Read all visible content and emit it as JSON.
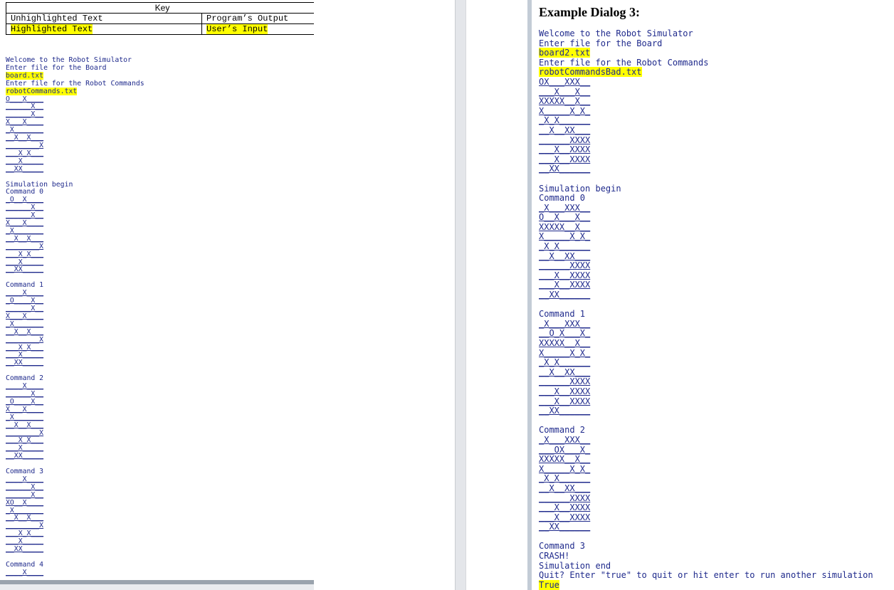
{
  "key": {
    "title": "Key",
    "rows": [
      {
        "left": "Unhighlighted Text",
        "right": "Program’s Output"
      },
      {
        "left": "Highlighted Text",
        "right": "User’s Input"
      }
    ]
  },
  "left_console": [
    {
      "t": "Welcome to the Robot Simulator",
      "k": "text"
    },
    {
      "t": "Enter file for the Board",
      "k": "text"
    },
    {
      "t": "board.txt",
      "k": "input"
    },
    {
      "t": "Enter file for the Robot Commands",
      "k": "text"
    },
    {
      "t": "robotCommands.txt",
      "k": "input"
    },
    {
      "t": "O___X____",
      "k": "grid"
    },
    {
      "t": "______X__",
      "k": "grid"
    },
    {
      "t": "______X__",
      "k": "grid"
    },
    {
      "t": "X___X____",
      "k": "grid"
    },
    {
      "t": "_X_______",
      "k": "grid"
    },
    {
      "t": "__X__X___",
      "k": "grid"
    },
    {
      "t": "________X",
      "k": "grid"
    },
    {
      "t": "___X_X___",
      "k": "grid"
    },
    {
      "t": "___X_____",
      "k": "grid"
    },
    {
      "t": "__XX_____",
      "k": "grid"
    },
    {
      "t": "",
      "k": "text"
    },
    {
      "t": "Simulation begin",
      "k": "text"
    },
    {
      "t": "Command 0",
      "k": "text"
    },
    {
      "t": "_O__X____",
      "k": "grid"
    },
    {
      "t": "______X__",
      "k": "grid"
    },
    {
      "t": "______X__",
      "k": "grid"
    },
    {
      "t": "X___X____",
      "k": "grid"
    },
    {
      "t": "_X_______",
      "k": "grid"
    },
    {
      "t": "__X__X___",
      "k": "grid"
    },
    {
      "t": "________X",
      "k": "grid"
    },
    {
      "t": "___X_X___",
      "k": "grid"
    },
    {
      "t": "___X_____",
      "k": "grid"
    },
    {
      "t": "__XX_____",
      "k": "grid"
    },
    {
      "t": "",
      "k": "text"
    },
    {
      "t": "Command 1",
      "k": "text"
    },
    {
      "t": "____X____",
      "k": "grid"
    },
    {
      "t": "_O____X__",
      "k": "grid"
    },
    {
      "t": "______X__",
      "k": "grid"
    },
    {
      "t": "X___X____",
      "k": "grid"
    },
    {
      "t": "_X_______",
      "k": "grid"
    },
    {
      "t": "__X__X___",
      "k": "grid"
    },
    {
      "t": "________X",
      "k": "grid"
    },
    {
      "t": "___X_X___",
      "k": "grid"
    },
    {
      "t": "___X_____",
      "k": "grid"
    },
    {
      "t": "__XX_____",
      "k": "grid"
    },
    {
      "t": "",
      "k": "text"
    },
    {
      "t": "Command 2",
      "k": "text"
    },
    {
      "t": "____X____",
      "k": "grid"
    },
    {
      "t": "______X__",
      "k": "grid"
    },
    {
      "t": "_O____X__",
      "k": "grid"
    },
    {
      "t": "X___X____",
      "k": "grid"
    },
    {
      "t": "_X_______",
      "k": "grid"
    },
    {
      "t": "__X__X___",
      "k": "grid"
    },
    {
      "t": "________X",
      "k": "grid"
    },
    {
      "t": "___X_X___",
      "k": "grid"
    },
    {
      "t": "___X_____",
      "k": "grid"
    },
    {
      "t": "__XX_____",
      "k": "grid"
    },
    {
      "t": "",
      "k": "text"
    },
    {
      "t": "Command 3",
      "k": "text"
    },
    {
      "t": "____X____",
      "k": "grid"
    },
    {
      "t": "______X__",
      "k": "grid"
    },
    {
      "t": "______X__",
      "k": "grid"
    },
    {
      "t": "XO__X____",
      "k": "grid"
    },
    {
      "t": "_X_______",
      "k": "grid"
    },
    {
      "t": "__X__X___",
      "k": "grid"
    },
    {
      "t": "________X",
      "k": "grid"
    },
    {
      "t": "___X_X___",
      "k": "grid"
    },
    {
      "t": "___X_____",
      "k": "grid"
    },
    {
      "t": "__XX_____",
      "k": "grid"
    },
    {
      "t": "",
      "k": "text"
    },
    {
      "t": "Command 4",
      "k": "text"
    },
    {
      "t": "____X____",
      "k": "grid"
    }
  ],
  "dialog_title": "Example Dialog 3:",
  "right_console": [
    {
      "t": "Welcome to the Robot Simulator",
      "k": "text"
    },
    {
      "t": "Enter file for the Board",
      "k": "text"
    },
    {
      "t": "board2.txt",
      "k": "input"
    },
    {
      "t": "Enter file for the Robot Commands",
      "k": "text"
    },
    {
      "t": "robotCommandsBad.txt",
      "k": "input"
    },
    {
      "t": "OX___XXX__",
      "k": "grid"
    },
    {
      "t": "___X___X__",
      "k": "grid"
    },
    {
      "t": "XXXXX__X__",
      "k": "grid"
    },
    {
      "t": "X_____X_X_",
      "k": "grid"
    },
    {
      "t": "_X_X______",
      "k": "grid"
    },
    {
      "t": "__X__XX___",
      "k": "grid"
    },
    {
      "t": "______XXXX",
      "k": "grid"
    },
    {
      "t": "___X__XXXX",
      "k": "grid"
    },
    {
      "t": "___X__XXXX",
      "k": "grid"
    },
    {
      "t": "__XX______",
      "k": "grid"
    },
    {
      "t": "",
      "k": "text"
    },
    {
      "t": "Simulation begin",
      "k": "text"
    },
    {
      "t": "Command 0",
      "k": "text"
    },
    {
      "t": "_X___XXX__",
      "k": "grid"
    },
    {
      "t": "O__X___X__",
      "k": "grid"
    },
    {
      "t": "XXXXX__X__",
      "k": "grid"
    },
    {
      "t": "X_____X_X_",
      "k": "grid"
    },
    {
      "t": "_X_X______",
      "k": "grid"
    },
    {
      "t": "__X__XX___",
      "k": "grid"
    },
    {
      "t": "______XXXX",
      "k": "grid"
    },
    {
      "t": "___X__XXXX",
      "k": "grid"
    },
    {
      "t": "___X__XXXX",
      "k": "grid"
    },
    {
      "t": "__XX______",
      "k": "grid"
    },
    {
      "t": "",
      "k": "text"
    },
    {
      "t": "Command 1",
      "k": "text"
    },
    {
      "t": "_X___XXX__",
      "k": "grid"
    },
    {
      "t": "__O_X___X_",
      "k": "grid"
    },
    {
      "t": "XXXXX__X__",
      "k": "grid"
    },
    {
      "t": "X_____X_X_",
      "k": "grid"
    },
    {
      "t": "_X_X______",
      "k": "grid"
    },
    {
      "t": "__X__XX___",
      "k": "grid"
    },
    {
      "t": "______XXXX",
      "k": "grid"
    },
    {
      "t": "___X__XXXX",
      "k": "grid"
    },
    {
      "t": "___X__XXXX",
      "k": "grid"
    },
    {
      "t": "__XX______",
      "k": "grid"
    },
    {
      "t": "",
      "k": "text"
    },
    {
      "t": "Command 2",
      "k": "text"
    },
    {
      "t": "_X___XXX__",
      "k": "grid"
    },
    {
      "t": "___OX___X_",
      "k": "grid"
    },
    {
      "t": "XXXXX__X__",
      "k": "grid"
    },
    {
      "t": "X_____X_X_",
      "k": "grid"
    },
    {
      "t": "_X_X______",
      "k": "grid"
    },
    {
      "t": "__X__XX___",
      "k": "grid"
    },
    {
      "t": "______XXXX",
      "k": "grid"
    },
    {
      "t": "___X__XXXX",
      "k": "grid"
    },
    {
      "t": "___X__XXXX",
      "k": "grid"
    },
    {
      "t": "__XX______",
      "k": "grid"
    },
    {
      "t": "",
      "k": "text"
    },
    {
      "t": "Command 3",
      "k": "text"
    },
    {
      "t": "CRASH!",
      "k": "text"
    },
    {
      "t": "Simulation end",
      "k": "text"
    },
    {
      "t": "Quit? Enter \"true\" to quit or hit enter to run another simulation",
      "k": "text"
    },
    {
      "t": "True",
      "k": "input"
    }
  ]
}
